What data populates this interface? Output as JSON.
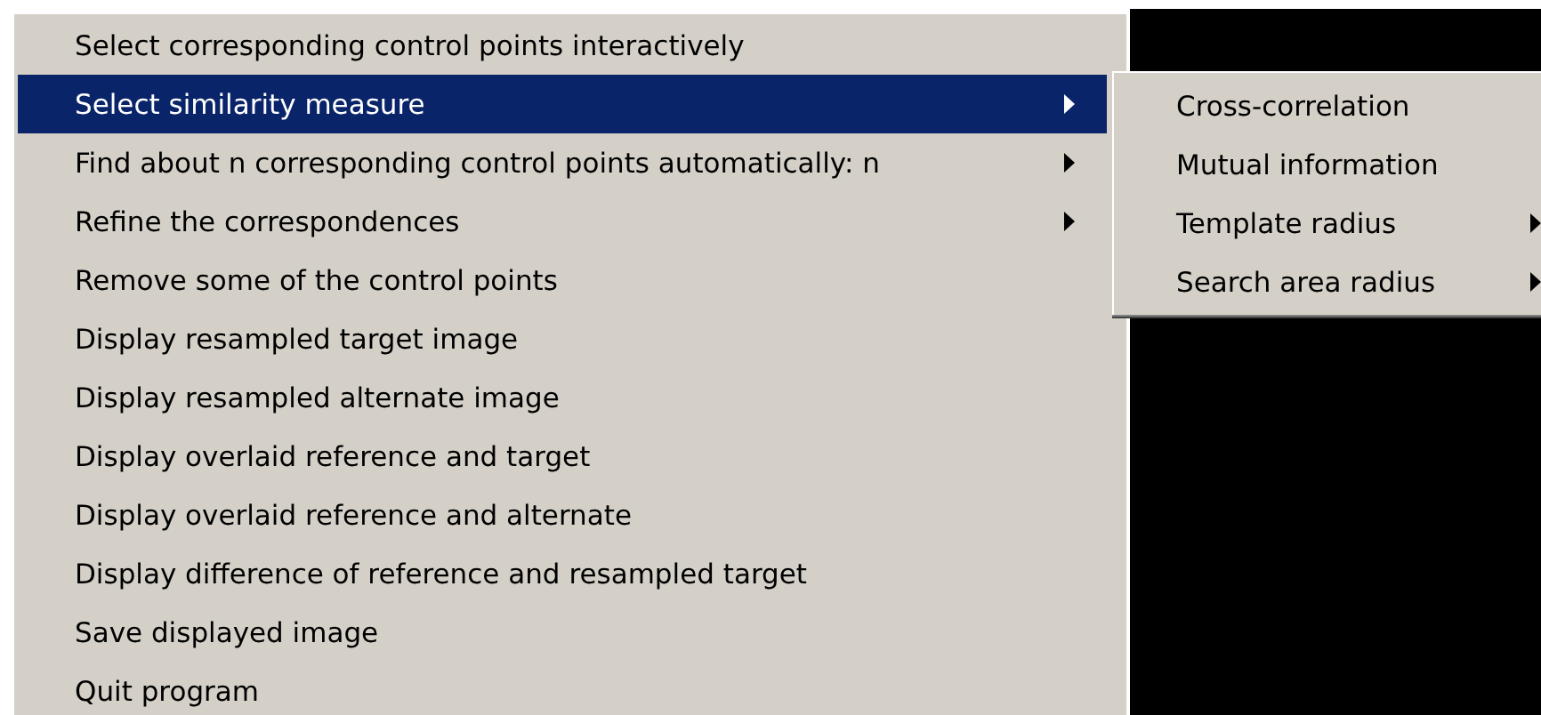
{
  "menu": {
    "items": [
      {
        "label": "Select corresponding control points interactively",
        "selected": false,
        "has_submenu": false
      },
      {
        "label": "Select similarity measure",
        "selected": true,
        "has_submenu": true
      },
      {
        "label": "Find about n corresponding control points automatically: n",
        "selected": false,
        "has_submenu": true
      },
      {
        "label": "Refine the correspondences",
        "selected": false,
        "has_submenu": true
      },
      {
        "label": "Remove some of the control points",
        "selected": false,
        "has_submenu": false
      },
      {
        "label": "Display resampled target image",
        "selected": false,
        "has_submenu": false
      },
      {
        "label": "Display resampled alternate image",
        "selected": false,
        "has_submenu": false
      },
      {
        "label": "Display overlaid reference and target",
        "selected": false,
        "has_submenu": false
      },
      {
        "label": "Display overlaid reference and alternate",
        "selected": false,
        "has_submenu": false
      },
      {
        "label": "Display difference of reference and resampled target",
        "selected": false,
        "has_submenu": false
      },
      {
        "label": "Save displayed image",
        "selected": false,
        "has_submenu": false
      },
      {
        "label": "Quit program",
        "selected": false,
        "has_submenu": false
      }
    ]
  },
  "submenu": {
    "items": [
      {
        "label": "Cross-correlation",
        "has_submenu": false
      },
      {
        "label": "Mutual information",
        "has_submenu": false
      },
      {
        "label": "Template radius",
        "has_submenu": true
      },
      {
        "label": "Search area radius",
        "has_submenu": true
      }
    ]
  }
}
